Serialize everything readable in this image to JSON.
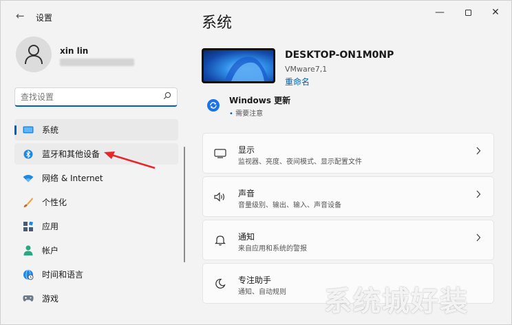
{
  "window": {
    "app_title": "设置",
    "back_glyph": "←",
    "minimize_glyph": "—",
    "close_glyph": "✕"
  },
  "user": {
    "name": "xin lin"
  },
  "search": {
    "placeholder": "查找设置"
  },
  "sidebar": {
    "items": [
      {
        "label": "系统",
        "icon": "system-display-icon",
        "state": "active"
      },
      {
        "label": "蓝牙和其他设备",
        "icon": "bluetooth-icon",
        "state": "hover"
      },
      {
        "label": "网络 & Internet",
        "icon": "wifi-icon",
        "state": "normal"
      },
      {
        "label": "个性化",
        "icon": "brush-icon",
        "state": "normal"
      },
      {
        "label": "应用",
        "icon": "apps-icon",
        "state": "normal"
      },
      {
        "label": "帐户",
        "icon": "person-icon",
        "state": "normal"
      },
      {
        "label": "时间和语言",
        "icon": "globe-clock-icon",
        "state": "normal"
      },
      {
        "label": "游戏",
        "icon": "gamepad-icon",
        "state": "normal"
      }
    ]
  },
  "main": {
    "title": "系统",
    "device": {
      "name": "DESKTOP-ON1M0NP",
      "model": "VMware7,1",
      "rename_label": "重命名"
    },
    "windows_update": {
      "title": "Windows 更新",
      "status": "需要注意"
    },
    "cards": [
      {
        "title": "显示",
        "subtitle": "监视器、亮度、夜间模式、显示配置文件",
        "icon": "monitor-icon"
      },
      {
        "title": "声音",
        "subtitle": "音量级别、输出、输入、声音设备",
        "icon": "speaker-icon"
      },
      {
        "title": "通知",
        "subtitle": "来自应用和系统的警报",
        "icon": "bell-icon"
      },
      {
        "title": "专注助手",
        "subtitle": "通知、自动规则",
        "icon": "moon-icon"
      }
    ]
  },
  "watermark": "系统城好装",
  "colors": {
    "accent": "#005fb8",
    "annotation_arrow": "#e8262a",
    "window_bg": "#f3f3f3",
    "card_bg": "#fbfbfb"
  }
}
